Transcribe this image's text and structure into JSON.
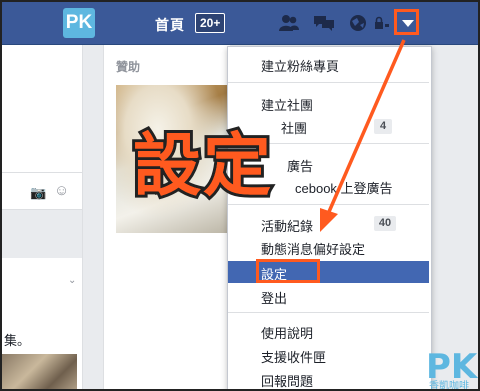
{
  "topbar": {
    "logo": "PK",
    "home": "首頁",
    "home_badge": "20+"
  },
  "sidebar_right": {
    "sponsor": "贊助"
  },
  "left_post": {
    "char": "集。"
  },
  "menu": {
    "items": [
      {
        "label": "建立粉絲專頁"
      },
      {
        "label": "建立社團"
      },
      {
        "label": "社團",
        "count": "4"
      },
      {
        "label": "廣告"
      },
      {
        "label": "cebook 上登廣告"
      },
      {
        "label": "活動紀錄",
        "count": "40"
      },
      {
        "label": "動態消息偏好設定"
      },
      {
        "label": "設定",
        "selected": true
      },
      {
        "label": "登出"
      },
      {
        "label": "使用說明"
      },
      {
        "label": "支援收件匣"
      },
      {
        "label": "回報問題"
      }
    ]
  },
  "overlay": {
    "big_text": "設定",
    "watermark": "PK",
    "watermark_sub": "香凱咖啡"
  },
  "colors": {
    "facebook_blue": "#3b5998",
    "highlight": "#ff5a1f",
    "selected_bg": "#4267b2"
  }
}
